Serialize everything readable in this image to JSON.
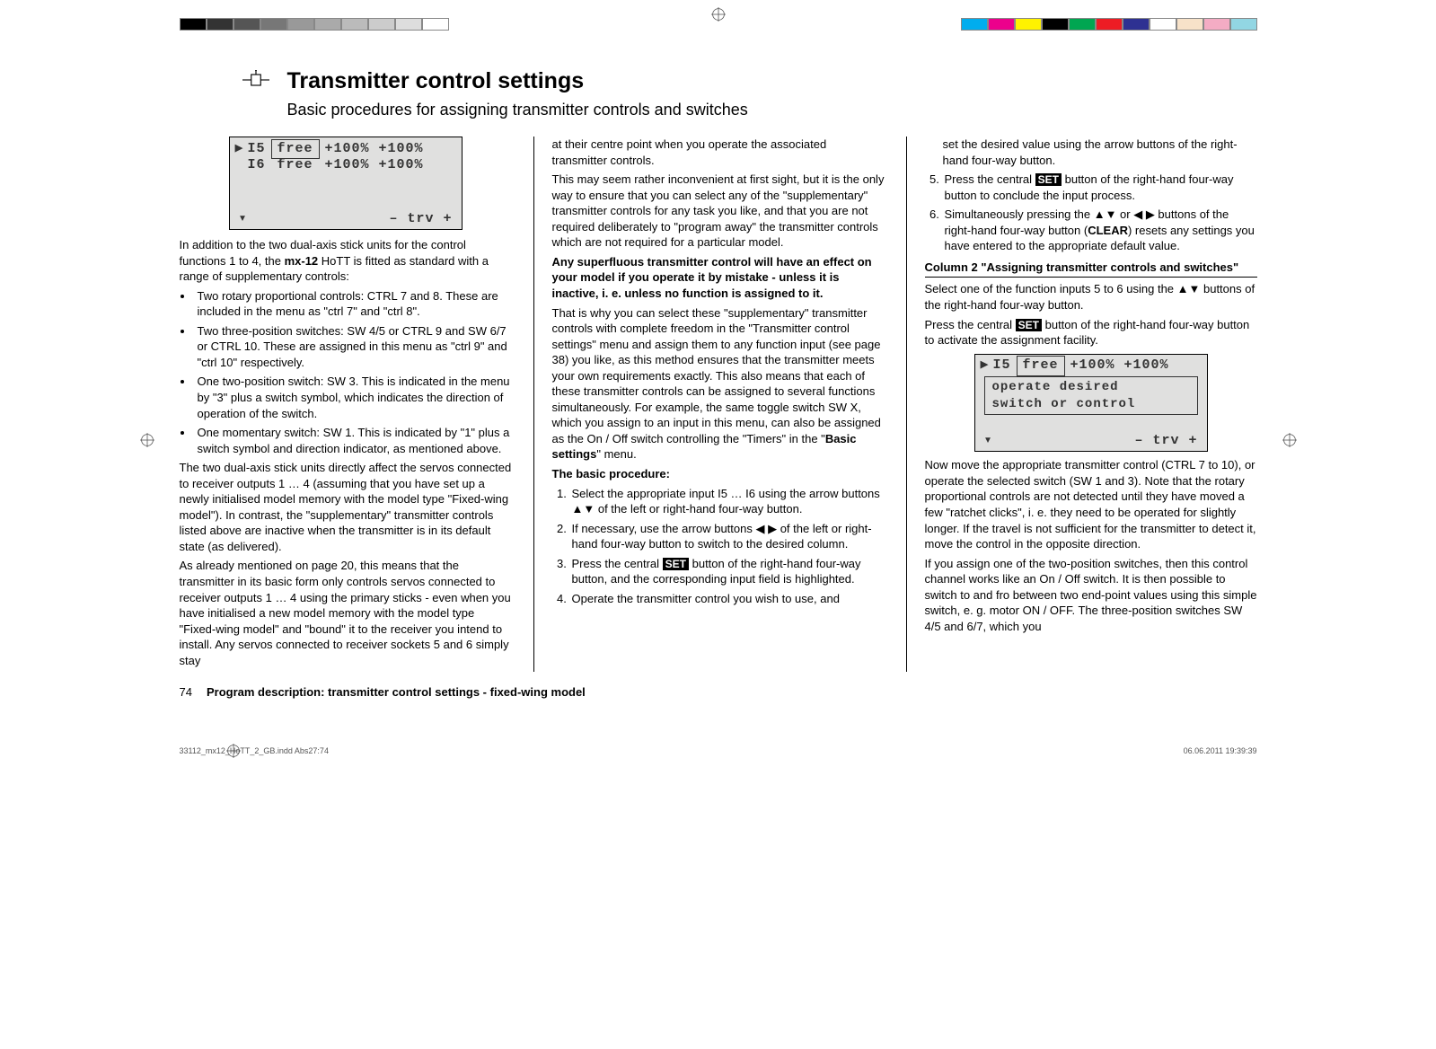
{
  "header": {
    "title": "Transmitter control settings",
    "subtitle": "Basic procedures for assigning transmitter controls and switches"
  },
  "lcd1": {
    "r1_ptr": "▶",
    "r1_label": "I5",
    "r1_box": "free",
    "r1_vals": "+100% +100%",
    "r2_label": "I6",
    "r2_free": "free",
    "r2_vals": "+100% +100%",
    "footer_left": "▾",
    "footer_right": "–  trv  +"
  },
  "lcd2": {
    "r1_ptr": "▶",
    "r1_label": "I5",
    "r1_box": "free",
    "r1_vals": "+100% +100%",
    "msg_line1": "operate desired",
    "msg_line2": "switch  or  control",
    "footer_left": "▾",
    "footer_right": "–  trv  +"
  },
  "col1": {
    "intro1": "In addition to the two dual-axis stick units for the control functions 1 to 4, the ",
    "intro1b": "mx-12",
    "intro1c": " HoTT is fitted as standard with a range of supplementary controls:",
    "b1": "Two rotary proportional controls: CTRL 7 and 8. These are included in the menu as \"ctrl 7\" and \"ctrl 8\".",
    "b2": "Two three-position switches: SW 4/5 or CTRL 9 and SW 6/7 or CTRL 10. These are assigned in this menu as \"ctrl 9\" and \"ctrl 10\" respectively.",
    "b3": "One two-position switch: SW 3. This is indicated in the menu by \"3\" plus a switch symbol, which indicates the direction of operation of the switch.",
    "b4": "One momentary switch: SW 1. This is indicated by \"1\" plus a switch symbol and direction indicator, as mentioned above.",
    "p2": "The two dual-axis stick units directly affect the servos connected to receiver outputs 1 … 4 (assuming that you have set up a newly initialised model memory with the model type \"Fixed-wing model\"). In contrast, the \"supplementary\" transmitter controls listed above are inactive when the transmitter is in its default state (as delivered).",
    "p3": "As already mentioned on page 20, this means that the transmitter in its basic form only controls servos connected to receiver outputs 1 … 4 using the primary sticks - even when you have initialised a new model memory with the model type \"Fixed-wing model\" and \"bound\" it to the receiver you intend to install. Any servos connected to receiver sockets 5 and 6 simply stay"
  },
  "col2": {
    "p1": "at their centre point when you operate the associated transmitter controls.",
    "p2": "This may seem rather inconvenient at first sight, but it is the only way to ensure that you can select any of the \"supplementary\" transmitter controls for any task you like, and that you are not required deliberately to \"program away\" the transmitter controls which are not required for a particular model.",
    "p3": "Any superfluous transmitter control will have an effect on your model if you operate it by mistake - unless it is inactive, i. e. unless no function is assigned to it.",
    "p4": "That is why you can select these \"supplementary\" transmitter controls with complete freedom in the \"Transmitter control settings\" menu and assign them to any function input (see page 38) you like, as this method ensures that the transmitter meets your own requirements exactly. This also means that each of these transmitter controls can be assigned to several functions simultaneously. For example, the same toggle switch SW X, which you assign to an input in this menu, can also be assigned as the On / Off switch controlling the \"Timers\" in the \"",
    "p4b": "Basic settings",
    "p4c": "\" menu.",
    "proc_head": "The basic procedure:",
    "n1": "Select the appropriate input I5 … I6 using the arrow buttons ▲▼ of the left or right-hand four-way button.",
    "n2": "If necessary, use the arrow buttons ◀ ▶ of the left or right-hand four-way button to switch to the desired column.",
    "n3a": "Press the central ",
    "n3b": " button of the right-hand four-way button, and the corresponding input field is highlighted.",
    "n4": "Operate the transmitter control you wish to use, and",
    "set": "SET"
  },
  "col3": {
    "cont": "set the desired value using the arrow buttons of the right-hand four-way button.",
    "n5a": "Press the central ",
    "n5b": " button of the right-hand four-way button to conclude the input process.",
    "n6a": "Simultaneously pressing the ▲▼ or ◀ ▶ buttons of the right-hand four-way button (",
    "n6b": "CLEAR",
    "n6c": ") resets any settings you have entered to the appropriate default value.",
    "sec_head": "Column 2 \"Assigning transmitter controls and switches\"",
    "p1": "Select one of the function inputs 5 to 6 using the ▲▼ buttons of the right-hand four-way button.",
    "p2a": "Press the central ",
    "p2b": " button of the right-hand four-way button to activate the assignment facility.",
    "p3": "Now move the appropriate transmitter control (CTRL 7 to 10), or operate the selected switch (SW 1 and 3). Note that the rotary proportional controls are not detected until they have moved a few \"ratchet clicks\", i. e. they need to be operated for slightly longer. If the travel is not sufficient for the transmitter to detect it, move the control in the opposite direction.",
    "p4": "If you assign one of the two-position switches, then this control channel works like an On / Off switch. It is then possible to switch to and fro between two end-point values using this simple switch, e. g. motor ON / OFF. The three-position switches SW 4/5 and 6/7, which you",
    "set": "SET"
  },
  "footer": {
    "page_num": "74",
    "title": "Program description: transmitter control settings - fixed-wing model"
  },
  "print": {
    "left": "33112_mx12_HoTT_2_GB.indd   Abs27:74",
    "right": "06.06.2011   19:39:39"
  },
  "colorbar": {
    "left": [
      "#000",
      "#333",
      "#555",
      "#777",
      "#999",
      "#aaa",
      "#bbb",
      "#ccc",
      "#ddd",
      "#fff"
    ],
    "right": [
      "#00adee",
      "#ec008c",
      "#fff200",
      "#000",
      "#00a651",
      "#ed1c24",
      "#2e3192",
      "#fff",
      "#f7e2c9",
      "#f4acc4",
      "#92d6e3"
    ]
  }
}
